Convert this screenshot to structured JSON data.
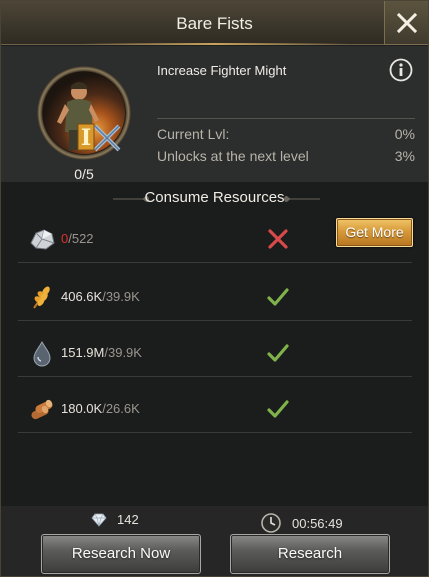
{
  "header": {
    "title": "Bare Fists"
  },
  "skill": {
    "level_count": "0/5",
    "tier_label": "I",
    "description": "Increase Fighter Might",
    "stats": [
      {
        "label": "Current Lvl:",
        "value": "0%"
      },
      {
        "label": "Unlocks at the next level",
        "value": "3%"
      }
    ]
  },
  "resources": {
    "title": "Consume Resources",
    "get_more_label": "Get More",
    "items": [
      {
        "icon": "ore-icon",
        "have": "0",
        "need": "/522",
        "status": "insufficient"
      },
      {
        "icon": "wheat-icon",
        "have": "406.6K",
        "need": "/39.9K",
        "status": "sufficient"
      },
      {
        "icon": "oil-drop-icon",
        "have": "151.9M",
        "need": "/39.9K",
        "status": "sufficient"
      },
      {
        "icon": "wood-logs-icon",
        "have": "180.0K",
        "need": "/26.6K",
        "status": "sufficient"
      }
    ]
  },
  "footer": {
    "gem_cost": "142",
    "time": "00:56:49",
    "research_now_label": "Research Now",
    "research_label": "Research"
  },
  "colors": {
    "insufficient": "#e0302a",
    "check": "#7fb24a",
    "cross": "#d84a4a",
    "gold": "#d79a3a"
  }
}
